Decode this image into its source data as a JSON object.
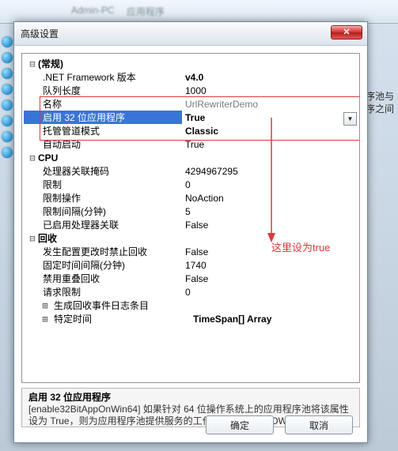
{
  "bg": {
    "blur1": "Admin-PC",
    "blur2": "应用程序",
    "side1": "序池与",
    "side2": "序之间"
  },
  "dialog": {
    "title": "高级设置",
    "close_glyph": "✕"
  },
  "grid": {
    "cat_general": "(常规)",
    "rows": {
      "net_fw": {
        "label": ".NET Framework 版本",
        "value": "v4.0"
      },
      "queue_len": {
        "label": "队列长度",
        "value": "1000"
      },
      "name": {
        "label": "名称",
        "value": "UrlRewriterDemo"
      },
      "enable32": {
        "label": "启用 32 位应用程序",
        "value": "True"
      },
      "pipeline": {
        "label": "托管管道模式",
        "value": "Classic"
      },
      "autostart": {
        "label": "自动启动",
        "value": "True"
      }
    },
    "cat_cpu": "CPU",
    "cpu": {
      "affinity": {
        "label": "处理器关联掩码",
        "value": "4294967295"
      },
      "limit": {
        "label": "限制",
        "value": "0"
      },
      "limit_action": {
        "label": "限制操作",
        "value": "NoAction"
      },
      "limit_interval": {
        "label": "限制间隔(分钟)",
        "value": "5"
      },
      "affinity_enabled": {
        "label": "已启用处理器关联",
        "value": "False"
      }
    },
    "cat_recycle": "回收",
    "recycle": {
      "no_recycle_cfg": {
        "label": "发生配置更改时禁止回收",
        "value": "False"
      },
      "fixed_interval": {
        "label": "固定时间间隔(分钟)",
        "value": "1740"
      },
      "no_overlap": {
        "label": "禁用重叠回收",
        "value": "False"
      },
      "request_limit": {
        "label": "请求限制",
        "value": "0"
      },
      "gen_events": {
        "label": "生成回收事件日志条目",
        "value": ""
      },
      "specific_time": {
        "label": "特定时间",
        "value": "TimeSpan[] Array"
      }
    }
  },
  "annotation": "这里设为true",
  "desc": {
    "title": "启用 32 位应用程序",
    "body": "[enable32BitAppOnWin64] 如果针对 64 位操作系统上的应用程序池将该属性设为 True，则为应用程序池提供服务的工作进程将处于 WOW64 (..."
  },
  "buttons": {
    "ok": "确定",
    "cancel": "取消"
  }
}
